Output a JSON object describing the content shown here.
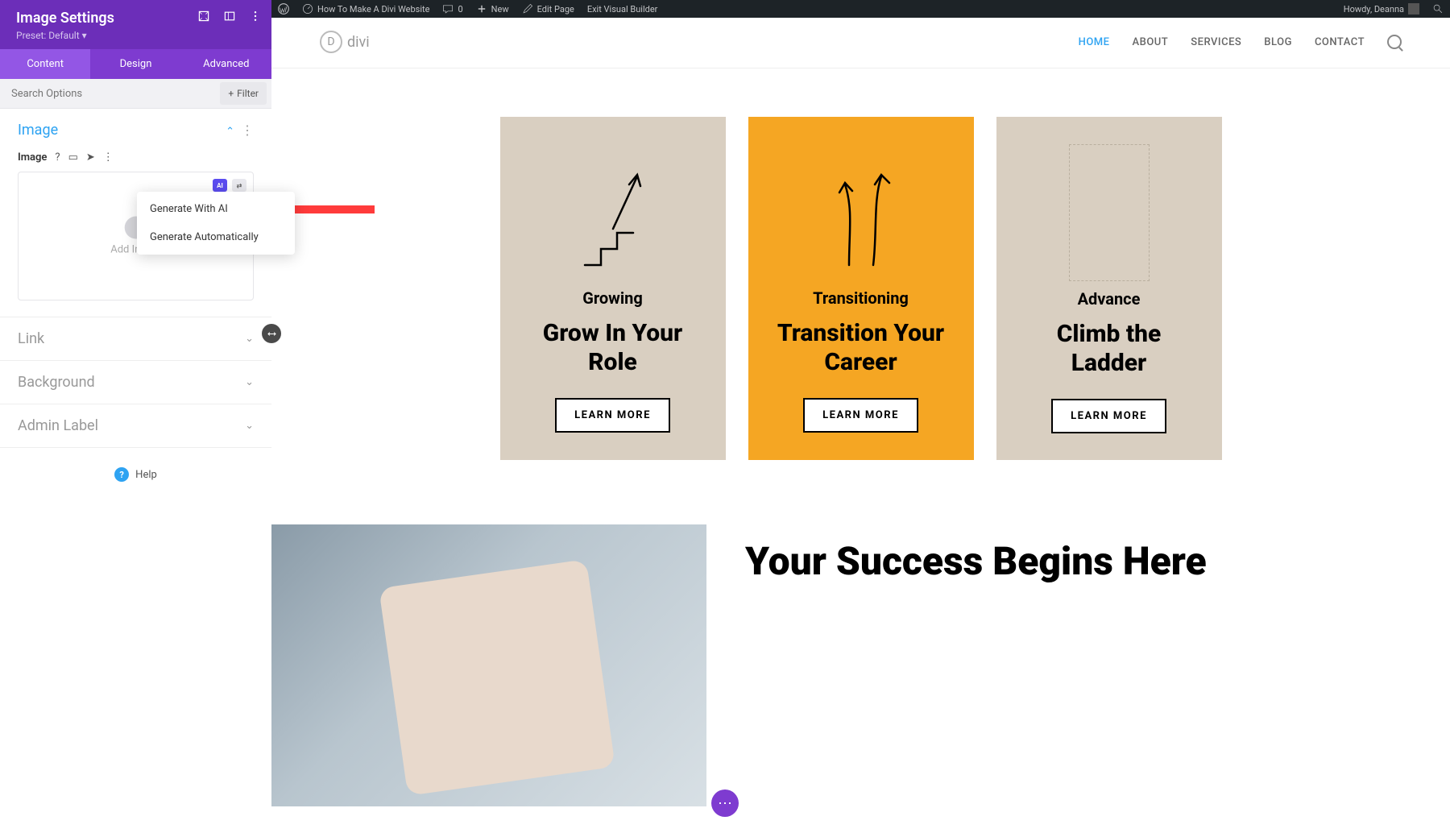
{
  "admin_bar": {
    "site_title": "How To Make A Divi Website",
    "comments": "0",
    "new": "New",
    "edit_page": "Edit Page",
    "exit_builder": "Exit Visual Builder",
    "howdy": "Howdy, Deanna"
  },
  "sidebar": {
    "title": "Image Settings",
    "preset": "Preset: Default",
    "tabs": {
      "content": "Content",
      "design": "Design",
      "advanced": "Advanced"
    },
    "search_placeholder": "Search Options",
    "filter": "Filter",
    "sections": {
      "image": "Image",
      "link": "Link",
      "background": "Background",
      "admin_label": "Admin Label"
    },
    "field_label": "Image",
    "upload_placeholder": "Add Image",
    "help": "Help"
  },
  "ai_menu": {
    "generate_ai": "Generate With AI",
    "generate_auto": "Generate Automatically"
  },
  "nav": {
    "home": "HOME",
    "about": "ABOUT",
    "services": "SERVICES",
    "blog": "BLOG",
    "contact": "CONTACT",
    "logo_text": "divi"
  },
  "cards": [
    {
      "subtitle": "Growing",
      "title": "Grow In Your Role",
      "btn": "LEARN MORE"
    },
    {
      "subtitle": "Transitioning",
      "title": "Transition Your Career",
      "btn": "LEARN MORE"
    },
    {
      "subtitle": "Advance",
      "title": "Climb the Ladder",
      "btn": "LEARN MORE"
    }
  ],
  "hero": {
    "title": "Your Success Begins Here"
  }
}
